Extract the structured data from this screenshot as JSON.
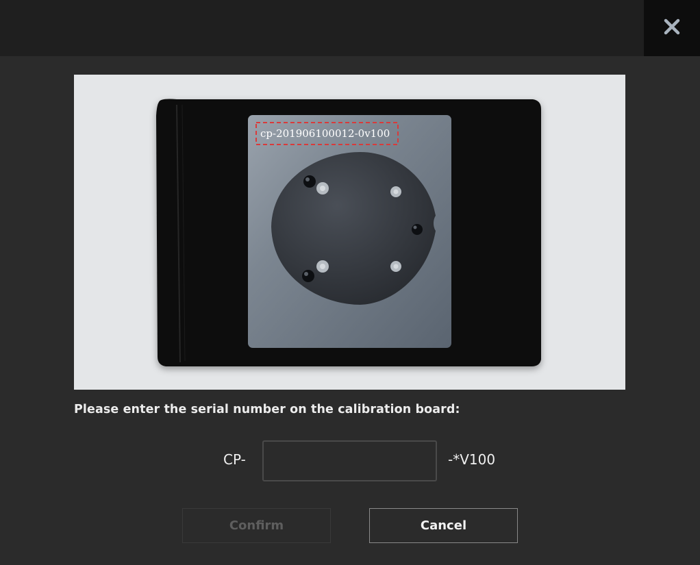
{
  "dialog": {
    "close_icon": "close-icon",
    "photo": {
      "serial_text": "cp-201906100012-0v100",
      "highlight_color": "#d93a3a"
    },
    "prompt": "Please enter the serial number on the calibration board:",
    "serial_prefix": "CP-",
    "serial_value": "",
    "serial_suffix": "-*V100",
    "confirm_label": "Confirm",
    "cancel_label": "Cancel"
  }
}
